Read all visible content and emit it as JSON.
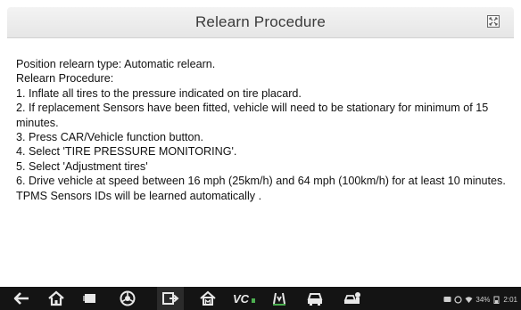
{
  "dialog": {
    "title": "Relearn Procedure",
    "close_icon": "close-icon"
  },
  "content": {
    "lines": [
      "Position relearn type: Automatic relearn.",
      "Relearn Procedure:",
      "1. Inflate all tires to the pressure indicated on tire placard.",
      "2. If replacement Sensors have been fitted, vehicle will need to be stationary for minimum of 15 minutes.",
      "3. Press CAR/Vehicle function button.",
      "4. Select 'TIRE PRESSURE MONITORING'.",
      "5. Select 'Adjustment tires'",
      "6. Drive vehicle at speed between 16 mph (25km/h) and 64 mph (100km/h) for at least 10 minutes. TPMS Sensors IDs will be learned automatically ."
    ]
  },
  "navbar": {
    "buttons": [
      "back-icon",
      "home-icon",
      "recent-apps-icon",
      "chrome-icon",
      "screenshot-icon",
      "diagnostic-home-icon",
      "vci-icon",
      "tpms-icon",
      "vehicle-icon",
      "car-service-icon"
    ],
    "status": {
      "battery_text": "34%",
      "time": "2:01"
    }
  }
}
